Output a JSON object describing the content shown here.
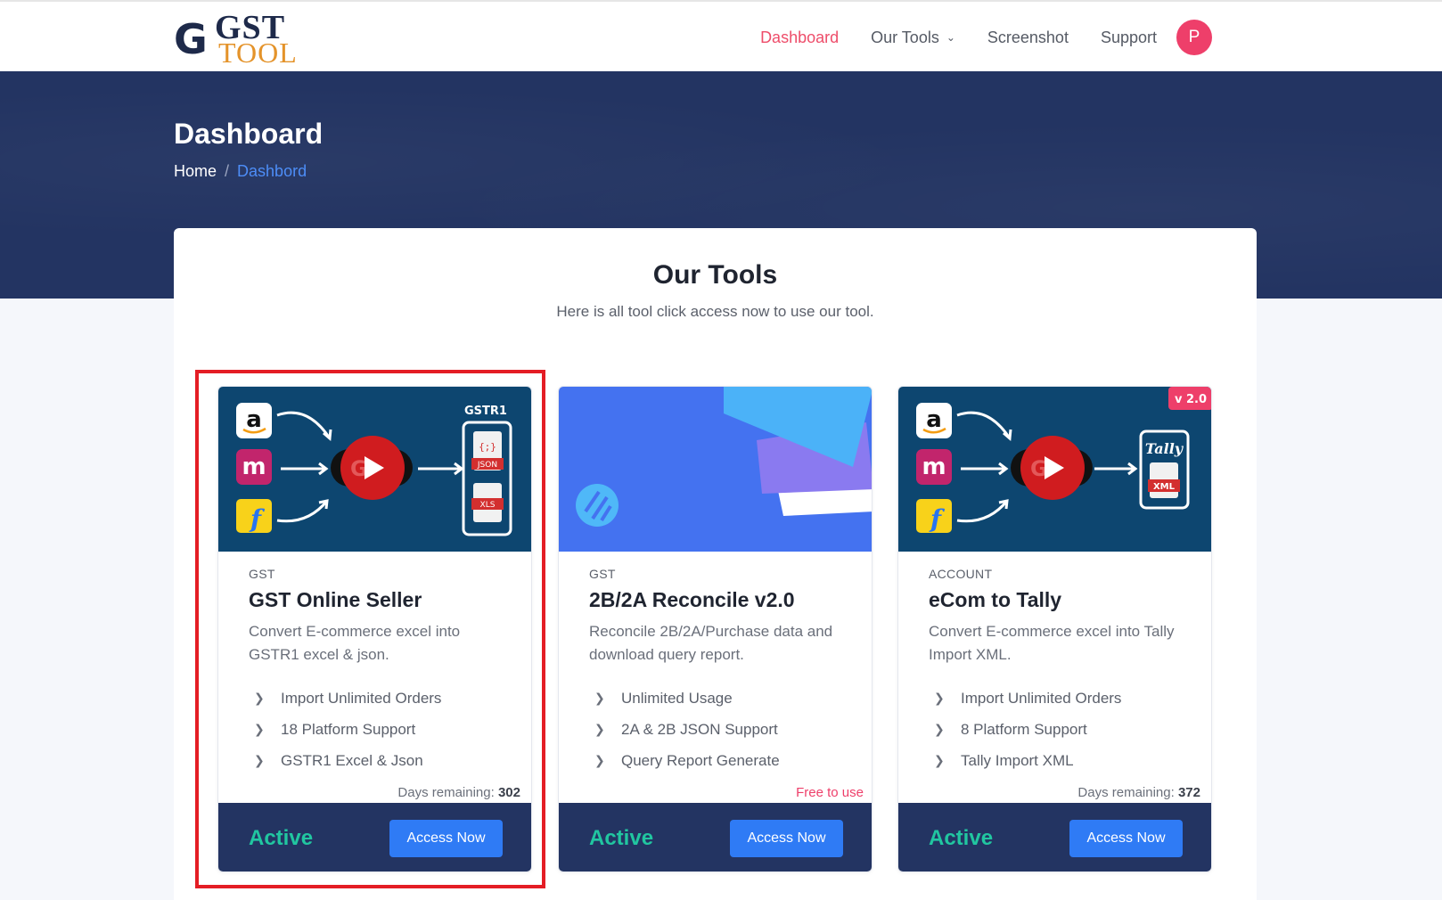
{
  "brand": {
    "logo_g": "G",
    "logo_top": "GST",
    "logo_bottom": "TOOL"
  },
  "nav": {
    "items": [
      {
        "label": "Dashboard",
        "active": true
      },
      {
        "label": "Our Tools",
        "dropdown": true
      },
      {
        "label": "Screenshot"
      },
      {
        "label": "Support"
      }
    ],
    "avatar_initial": "P"
  },
  "hero": {
    "title": "Dashboard",
    "breadcrumb": {
      "home": "Home",
      "separator": "/",
      "current": "Dashbord"
    }
  },
  "section": {
    "title": "Our Tools",
    "subtitle": "Here is all tool click access now to use our tool."
  },
  "cards": [
    {
      "category": "GST",
      "title": "GST Online Seller",
      "description": "Convert E-commerce excel into GSTR1 excel & json.",
      "features": [
        "Import Unlimited Orders",
        "18 Platform Support",
        "GSTR1 Excel & Json"
      ],
      "remaining_label": "Days remaining:",
      "remaining_value": "302",
      "status": "Active",
      "button": "Access Now",
      "image": {
        "right_label": "GSTR1",
        "file1": "JSON",
        "file2": "XLS",
        "file1_glyph": "{;}"
      }
    },
    {
      "category": "GST",
      "title": "2B/2A Reconcile v2.0",
      "description": "Reconcile 2B/2A/Purchase data and download query report.",
      "features": [
        "Unlimited Usage",
        "2A & 2B JSON Support",
        "Query Report Generate"
      ],
      "free_label": "Free to use",
      "status": "Active",
      "button": "Access Now"
    },
    {
      "category": "ACCOUNT",
      "title": "eCom to Tally",
      "description": "Convert E-commerce excel into Tally Import XML.",
      "features": [
        "Import Unlimited Orders",
        "8 Platform Support",
        "Tally Import XML"
      ],
      "remaining_label": "Days remaining:",
      "remaining_value": "372",
      "status": "Active",
      "button": "Access Now",
      "image": {
        "badge": "v 2.0",
        "right_label": "Tally",
        "file1": "XML"
      }
    }
  ],
  "colors": {
    "navy": "#233462",
    "accent_pink": "#ee3f6a",
    "button_blue": "#2f7bf5",
    "status_green": "#21c6a0",
    "highlight_red": "#e41d25"
  }
}
